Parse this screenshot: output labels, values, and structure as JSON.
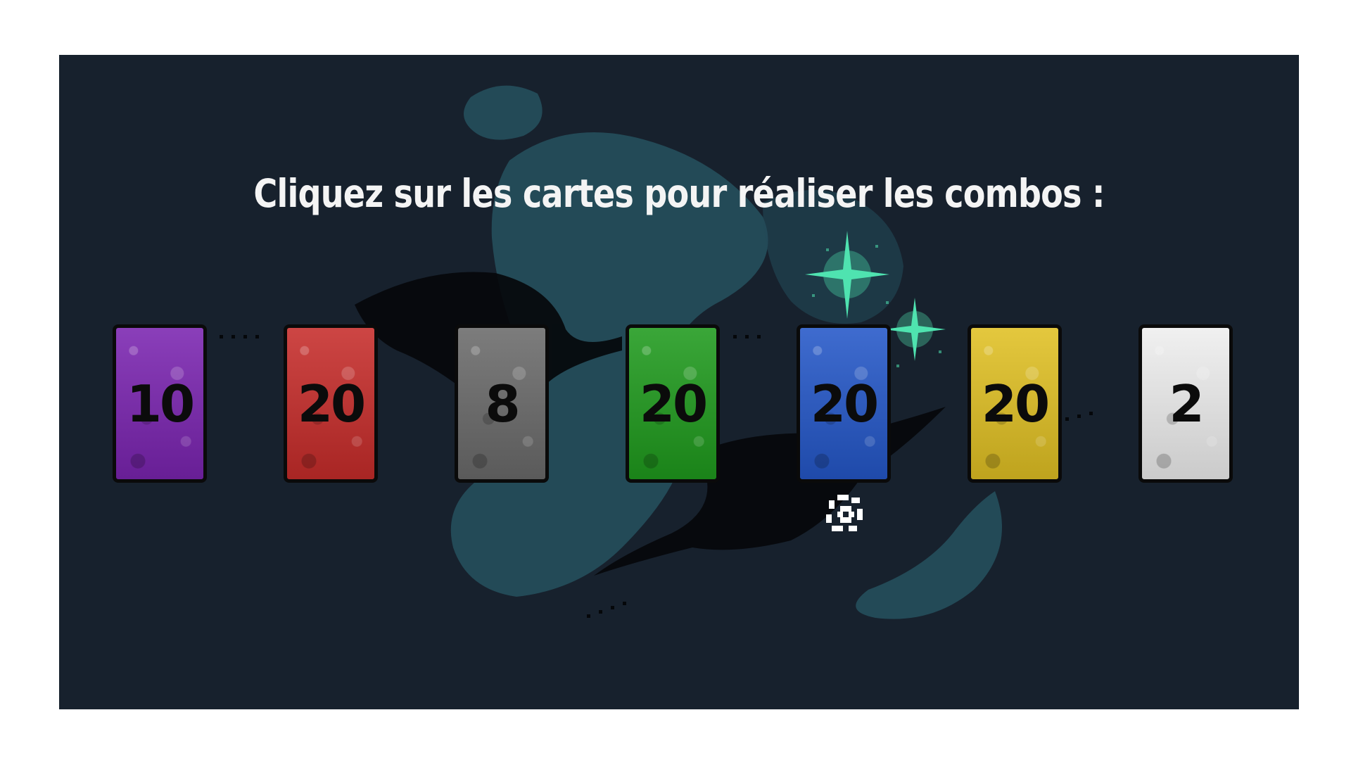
{
  "instruction": "Cliquez sur les cartes pour réaliser les combos :",
  "colors": {
    "background": "#17212d",
    "nebula": "#244d5a",
    "sparkle": "#4fe3b0"
  },
  "cards": [
    {
      "value": "10",
      "color": "#7a24b0"
    },
    {
      "value": "20",
      "color": "#c62c2a"
    },
    {
      "value": "8",
      "color": "#6a6a6a"
    },
    {
      "value": "20",
      "color": "#1f9a1d"
    },
    {
      "value": "20",
      "color": "#2457c8"
    },
    {
      "value": "20",
      "color": "#e0c023"
    },
    {
      "value": "2",
      "color": "#eeeeee"
    }
  ],
  "cursor": {
    "icon": "pixel-spinner-icon"
  }
}
